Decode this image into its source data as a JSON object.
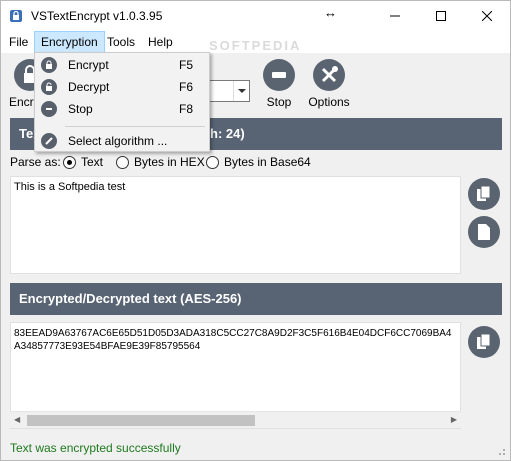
{
  "window": {
    "title": "VSTextEncrypt v1.0.3.95"
  },
  "menu": {
    "file": "File",
    "encryption": "Encryption",
    "tools": "Tools",
    "help": "Help"
  },
  "toolbar": {
    "encrypt_label_partial": "Encry",
    "stop_label": "Stop",
    "options_label": "Options"
  },
  "dropdown": {
    "items": [
      {
        "label": "Encrypt",
        "shortcut": "F5"
      },
      {
        "label": "Decrypt",
        "shortcut": "F6"
      },
      {
        "label": "Stop",
        "shortcut": "F8"
      }
    ],
    "algorithm_label": "Select algorithm ..."
  },
  "plain_section": {
    "header_left": "Text",
    "header_right": "h: 24)",
    "parse_label": "Parse as:",
    "options": [
      "Text",
      "Bytes in HEX",
      "Bytes in Base64"
    ],
    "selected": "Text",
    "content": "This is a Softpedia test"
  },
  "enc_section": {
    "header": "Encrypted/Decrypted text (AES-256)",
    "line1": "83EEAD9A63767AC6E65D51D05D3ADA318C5CC27C8A9D2F3C5F616B4E04DCF6CC7069BA4",
    "line2": "A34857773E93E54BFAE9E39F85795564"
  },
  "status": {
    "message": "Text was encrypted successfully"
  },
  "watermark": "SOFTPEDIA",
  "colors": {
    "header_bg": "#586473",
    "icon_dark": "#5a6470",
    "status_green": "#1e7a1e",
    "menu_active": "#cce8ff"
  }
}
